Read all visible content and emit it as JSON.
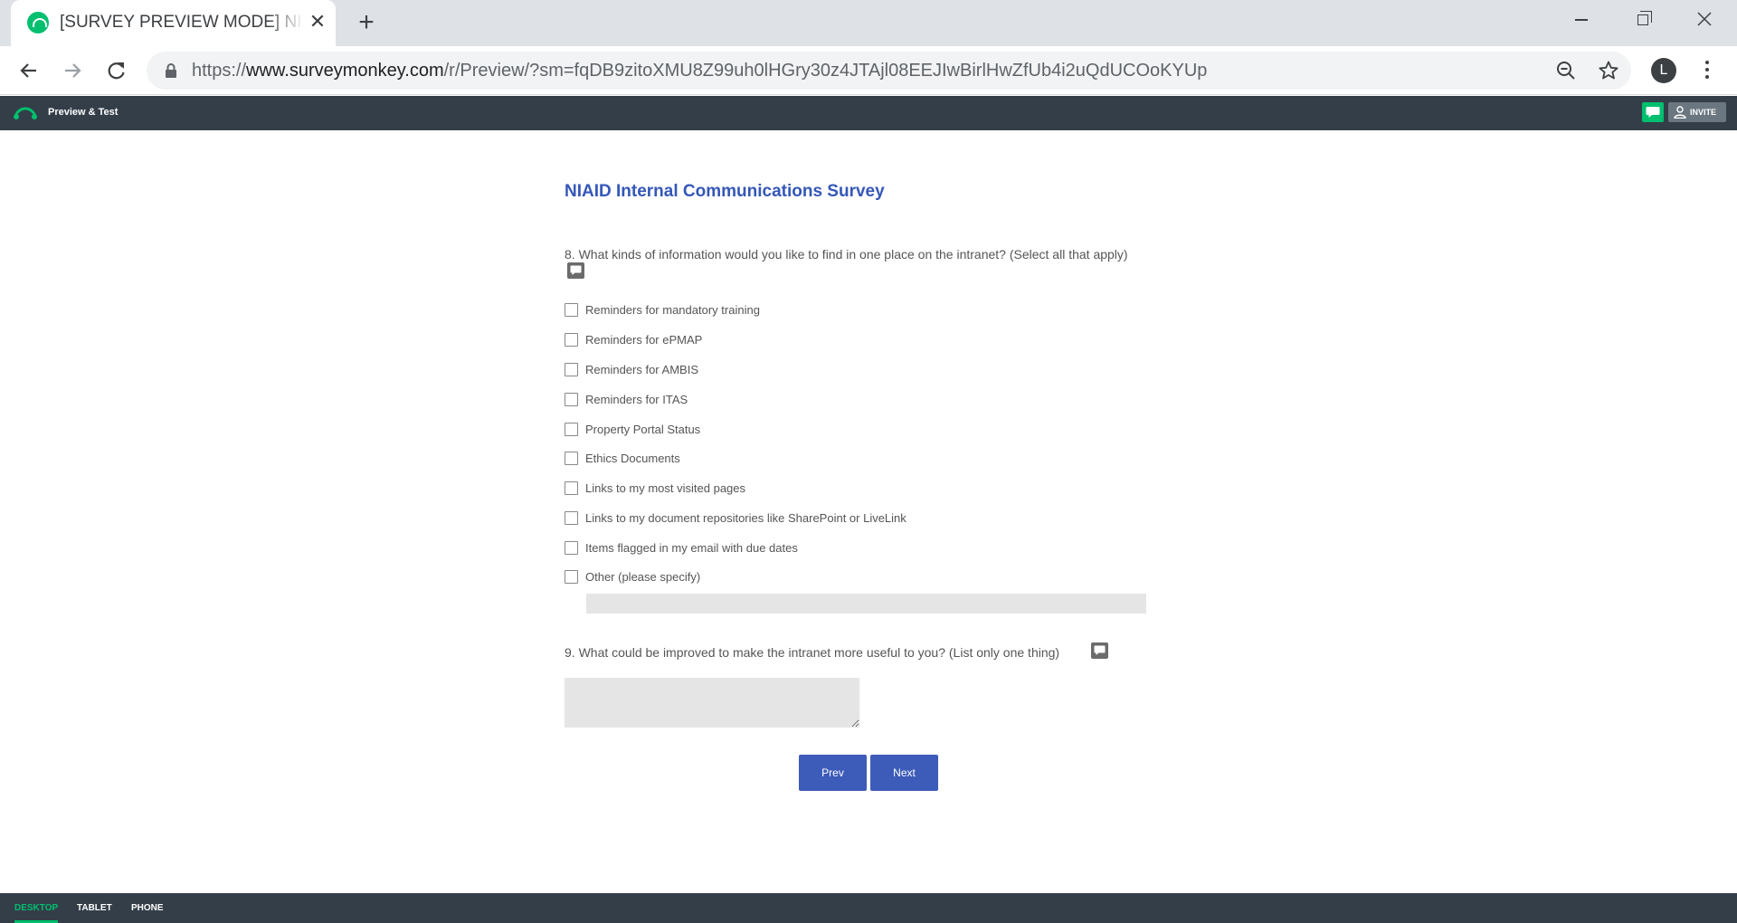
{
  "browser": {
    "tab_title": "[SURVEY PREVIEW MODE] NIAID Internal Communications Survey",
    "tab_close": "✕",
    "new_tab": "+",
    "url_prefix": "https://",
    "url_host": "www.surveymonkey.com",
    "url_path": "/r/Preview/?sm=fqDB9zitoXMU8Z99uh0lHGry30z4JTAjl08EEJIwBirlHwZfUb4i2uQdUCOoKYUp",
    "profile_initial": "L"
  },
  "header": {
    "title": "Preview & Test",
    "invite_label": "INVITE",
    "brand_color": "#00bf6f"
  },
  "survey": {
    "title": "NIAID Internal Communications Survey",
    "q8": {
      "text": "8. What kinds of information would you like to find in one place on the intranet? (Select all that apply)",
      "options": [
        "Reminders for mandatory training",
        "Reminders for ePMAP",
        "Reminders for AMBIS",
        "Reminders for ITAS",
        "Property Portal Status",
        "Ethics Documents",
        "Links to my most visited pages",
        "Links to my document repositories like SharePoint or LiveLink",
        "Items flagged in my email with due dates",
        "Other (please specify)"
      ],
      "other_value": ""
    },
    "q9": {
      "text": "9. What could be improved to make the intranet more useful to you? (List only one thing)",
      "answer": ""
    },
    "prev_label": "Prev",
    "next_label": "Next"
  },
  "device_tabs": {
    "desktop": "DESKTOP",
    "tablet": "TABLET",
    "phone": "PHONE",
    "active": "DESKTOP"
  }
}
